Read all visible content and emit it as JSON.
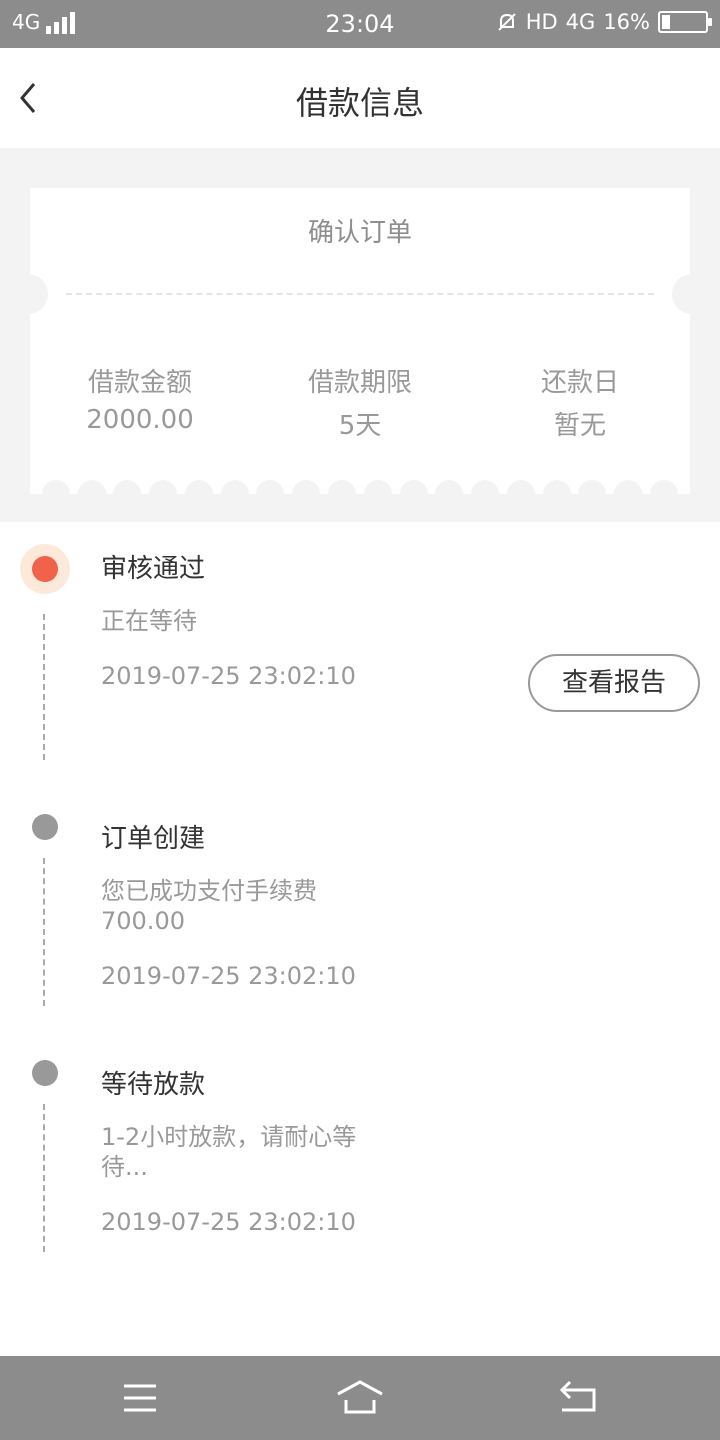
{
  "status_bar": {
    "network": "4G",
    "time": "23:04",
    "hd": "HD",
    "network_right": "4G",
    "battery": "16%"
  },
  "header": {
    "title": "借款信息",
    "back_icon": "chevron-left-icon"
  },
  "ticket": {
    "title": "确认订单",
    "stats": [
      {
        "label": "借款金额",
        "value": "2000.00"
      },
      {
        "label": "借款期限",
        "value": "5天"
      },
      {
        "label": "还款日",
        "value": "暂无"
      }
    ]
  },
  "timeline": {
    "steps": [
      {
        "title": "审核通过",
        "desc": "正在等待",
        "time": "2019-07-25 23:02:10",
        "button": "查看报告",
        "active": true
      },
      {
        "title": "订单创建",
        "desc": "您已成功支付手续费700.00",
        "time": "2019-07-25 23:02:10"
      },
      {
        "title": "等待放款",
        "desc": "1-2小时放款，请耐心等待...",
        "time": "2019-07-25 23:02:10"
      }
    ],
    "colors": {
      "active": "#f0624a",
      "inactive": "#999999"
    }
  },
  "navbar": {
    "icons": [
      "menu-icon",
      "home-icon",
      "back-icon"
    ]
  }
}
